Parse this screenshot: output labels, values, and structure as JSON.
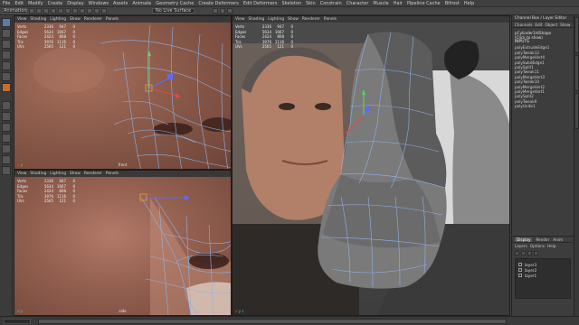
{
  "menu": [
    "File",
    "Edit",
    "Modify",
    "Create",
    "Display",
    "Windows",
    "Assets",
    "Animate",
    "Geometry Cache",
    "Create Deformers",
    "Edit Deformers",
    "Skeleton",
    "Skin",
    "Constrain",
    "Character",
    "Muscle",
    "Hair",
    "Pipeline Cache",
    "Bifrost",
    "Help"
  ],
  "statusline": {
    "mode": "Animation",
    "surface": "No Live Surface"
  },
  "viewport_menu": [
    "View",
    "Shading",
    "Lighting",
    "Show",
    "Renderer",
    "Panels"
  ],
  "hud_tl": [
    {
      "k": "Verts",
      "v": "2336",
      "w": "947",
      "z": "0"
    },
    {
      "k": "Edges",
      "v": "5634",
      "w": "1667",
      "z": "0"
    },
    {
      "k": "Faces",
      "v": "2424",
      "w": "808",
      "z": "0"
    },
    {
      "k": "Tris",
      "v": "3976",
      "w": "1116",
      "z": "0"
    },
    {
      "k": "UVs",
      "v": "2565",
      "w": "121",
      "z": "0"
    }
  ],
  "hud_bl": [
    {
      "k": "Verts",
      "v": "2336",
      "w": "947",
      "z": "0"
    },
    {
      "k": "Edges",
      "v": "5634",
      "w": "1667",
      "z": "0"
    },
    {
      "k": "Faces",
      "v": "2424",
      "w": "808",
      "z": "0"
    },
    {
      "k": "Tris",
      "v": "3976",
      "w": "1116",
      "z": "0"
    },
    {
      "k": "UVs",
      "v": "2565",
      "w": "121",
      "z": "0"
    }
  ],
  "hud_r": [
    {
      "k": "Verts",
      "v": "2336",
      "w": "947",
      "z": "0"
    },
    {
      "k": "Edges",
      "v": "5634",
      "w": "1667",
      "z": "0"
    },
    {
      "k": "Faces",
      "v": "2424",
      "w": "808",
      "z": "0"
    },
    {
      "k": "Tris",
      "v": "3976",
      "w": "1116",
      "z": "0"
    },
    {
      "k": "UVs",
      "v": "2565",
      "w": "121",
      "z": "0"
    }
  ],
  "cam_tl": "front",
  "cam_bl": "side",
  "channelbox": {
    "title": "Channel Box / Layer Editor",
    "menu": [
      "Channels",
      "Edit",
      "Object",
      "Show"
    ],
    "object": "pCylinder1HiShape",
    "object_hint": "(Click to show)",
    "inputs_label": "INPUTS",
    "inputs": [
      "polyExtrudeEdge1",
      "polyTweak12",
      "polyMergeVert4",
      "polySubdEdge1",
      "polySplit1",
      "polyTweak11",
      "polyMergeVert3",
      "polyTweak10",
      "polyMergeVert2",
      "polyMergeVert1",
      "polySplit2",
      "polyTweak9",
      "polyUnite1"
    ]
  },
  "layers": {
    "tabs": [
      "Display",
      "Render",
      "Anim"
    ],
    "active_tab": "Display",
    "menu": [
      "Layers",
      "Options",
      "Help"
    ],
    "items": [
      "layer3",
      "layer2",
      "layer1"
    ]
  },
  "colors": {
    "wire": "#8fb3e6",
    "accent": "#c66d2a"
  }
}
